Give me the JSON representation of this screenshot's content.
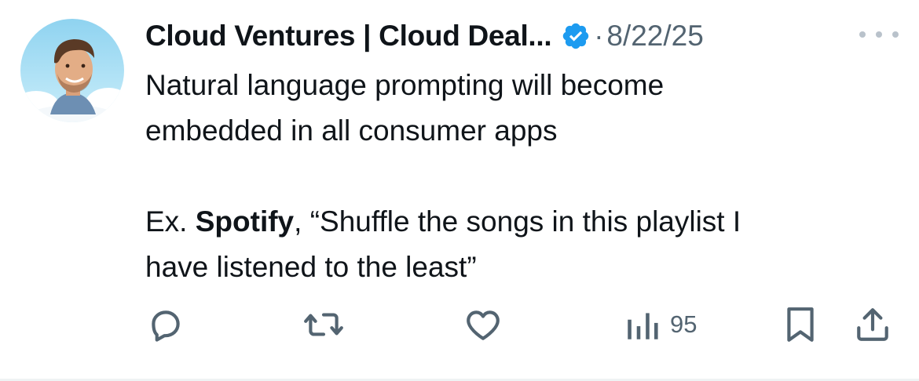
{
  "author": {
    "display_name": "Cloud Ventures | Cloud Deal...",
    "verified": true,
    "separator": "·",
    "date": "8/22/25",
    "avatar": "avatar-man-in-clouds"
  },
  "tweet": {
    "line1": "Natural language prompting will become",
    "line2": "embedded in all consumer apps",
    "ex_prefix": "Ex. ",
    "ex_bold": "Spotify",
    "ex_rest": ", “Shuffle the songs in this playlist I",
    "line4": "have listened to the least”"
  },
  "actions": {
    "reply": "reply-icon",
    "repost": "repost-icon",
    "like": "like-icon",
    "views": "views-icon",
    "views_count": "95",
    "bookmark": "bookmark-icon",
    "share": "share-icon"
  },
  "colors": {
    "text": "#0f1419",
    "muted": "#536471",
    "verified_blue": "#1d9bf0"
  }
}
